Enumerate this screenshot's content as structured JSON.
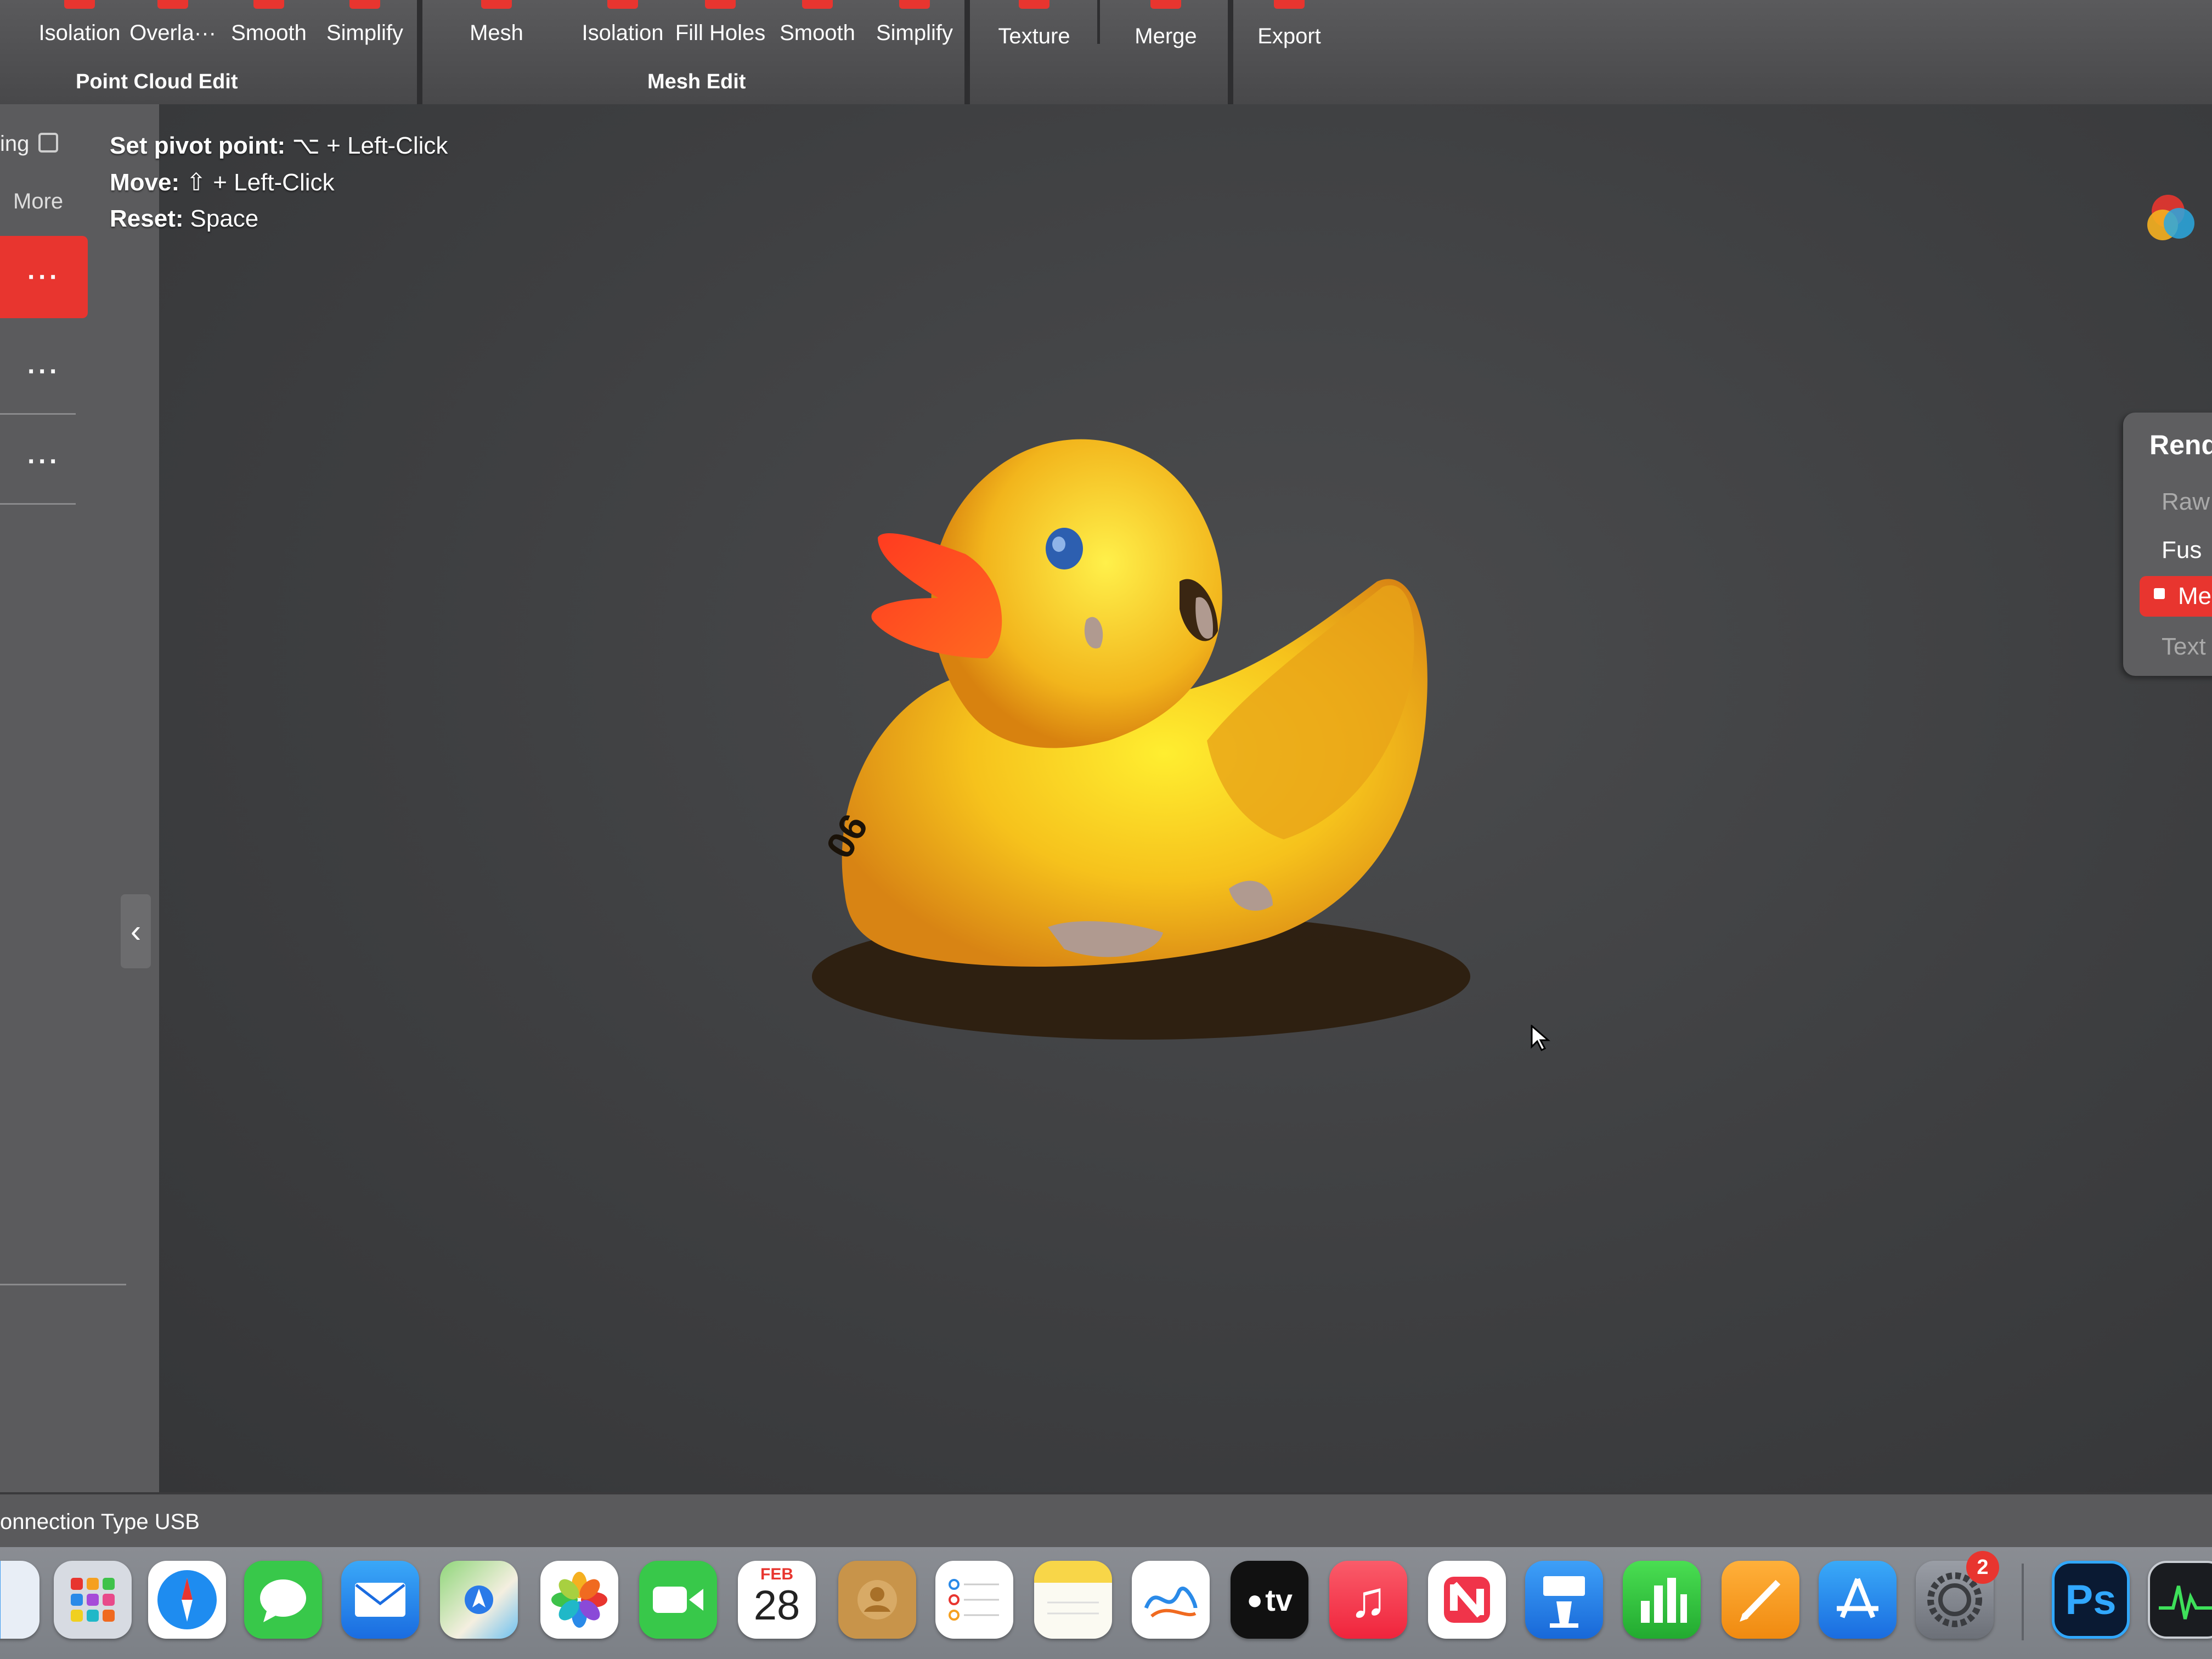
{
  "toolbar": {
    "point_cloud_edit": {
      "buttons": [
        "Isolation",
        "Overla···",
        "Smooth",
        "Simplify"
      ],
      "group_label": "Point Cloud Edit"
    },
    "mesh_button": "Mesh",
    "mesh_edit": {
      "buttons": [
        "Isolation",
        "Fill Holes",
        "Smooth",
        "Simplify"
      ],
      "group_label": "Mesh Edit"
    },
    "texture_button": "Texture",
    "merge_button": "Merge",
    "export_button": "Export",
    "accent_color": "#e8352f"
  },
  "sidebar": {
    "top_label": "ing",
    "more_label": "More",
    "dots": [
      "···",
      "···",
      "···"
    ],
    "collapse_glyph": "‹"
  },
  "viewport": {
    "hints": [
      {
        "key": "Set pivot point:",
        "value": "⌥ + Left-Click"
      },
      {
        "key": "Move:",
        "value": "⇧ + Left-Click"
      },
      {
        "key": "Reset:",
        "value": "Space"
      }
    ],
    "model_label": "06"
  },
  "render_panel": {
    "title": "Rend",
    "options": [
      "Raw",
      "Fus",
      "Mes",
      "Text"
    ],
    "selected": "Mes"
  },
  "status_bar": {
    "connection": "onnection Type USB"
  },
  "dock": {
    "calendar_month": "FEB",
    "calendar_day": "28",
    "settings_badge": "2",
    "tv_label": "tv",
    "ps_label": "Ps",
    "icons": [
      "finder-icon",
      "launchpad-icon",
      "safari-icon",
      "messages-icon",
      "mail-icon",
      "maps-icon",
      "photos-icon",
      "facetime-icon",
      "calendar-icon",
      "contacts-icon",
      "reminders-icon",
      "notes-icon",
      "freeform-icon",
      "appletv-icon",
      "music-icon",
      "news-icon",
      "keynote-icon",
      "numbers-icon",
      "pages-icon",
      "appstore-icon",
      "system-settings-icon",
      "photoshop-icon",
      "activity-monitor-icon"
    ]
  }
}
